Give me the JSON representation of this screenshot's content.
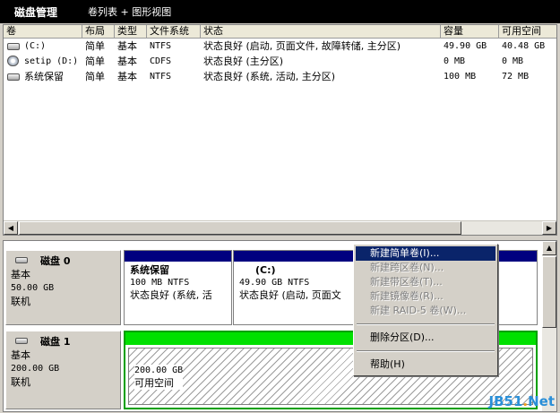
{
  "title_bar": {
    "app_title": "磁盘管理",
    "view_label": "卷列表 + 图形视图"
  },
  "volume_list": {
    "columns": [
      "卷",
      "布局",
      "类型",
      "文件系统",
      "状态",
      "容量",
      "可用空间"
    ],
    "rows": [
      {
        "volume": "(C:)",
        "layout": "简单",
        "type": "基本",
        "fs": "NTFS",
        "status": "状态良好 (启动, 页面文件, 故障转储, 主分区)",
        "capacity": "49.90 GB",
        "free": "40.48 GB",
        "icon": "hard-drive-icon"
      },
      {
        "volume": "setip (D:)",
        "layout": "简单",
        "type": "基本",
        "fs": "CDFS",
        "status": "状态良好 (主分区)",
        "capacity": "0 MB",
        "free": "0 MB",
        "icon": "cd-drive-icon"
      },
      {
        "volume": "系统保留",
        "layout": "简单",
        "type": "基本",
        "fs": "NTFS",
        "status": "状态良好 (系统, 活动, 主分区)",
        "capacity": "100 MB",
        "free": "72 MB",
        "icon": "hard-drive-icon"
      }
    ]
  },
  "disks": [
    {
      "name": "磁盘 0",
      "kind": "基本",
      "size": "50.00 GB",
      "state": "联机",
      "partitions": [
        {
          "name": "系统保留",
          "detail": "100 MB NTFS",
          "status": "状态良好 (系统, 活"
        },
        {
          "name": "(C:)",
          "detail": "49.90 GB NTFS",
          "status": "状态良好 (启动, 页面文"
        }
      ]
    },
    {
      "name": "磁盘 1",
      "kind": "基本",
      "size": "200.00 GB",
      "state": "联机",
      "partitions": [
        {
          "name": "",
          "detail": "200.00 GB",
          "status": "可用空间"
        }
      ]
    }
  ],
  "context_menu": {
    "items": [
      {
        "label": "新建简单卷(I)...",
        "state": "selected"
      },
      {
        "label": "新建跨区卷(N)...",
        "state": "disabled"
      },
      {
        "label": "新建带区卷(T)...",
        "state": "disabled"
      },
      {
        "label": "新建镜像卷(R)...",
        "state": "disabled"
      },
      {
        "label": "新建 RAID-5 卷(W)...",
        "state": "disabled"
      },
      {
        "label": "删除分区(D)...",
        "state": "enabled"
      },
      {
        "label": "帮助(H)",
        "state": "enabled"
      }
    ]
  },
  "watermark": {
    "brand": "JB51",
    "dot": ".",
    "suffix": "Net"
  },
  "colors": {
    "primary_partition_bar": "#00007f",
    "free_space_bar": "#00e000",
    "menu_highlight": "#0a246a"
  }
}
